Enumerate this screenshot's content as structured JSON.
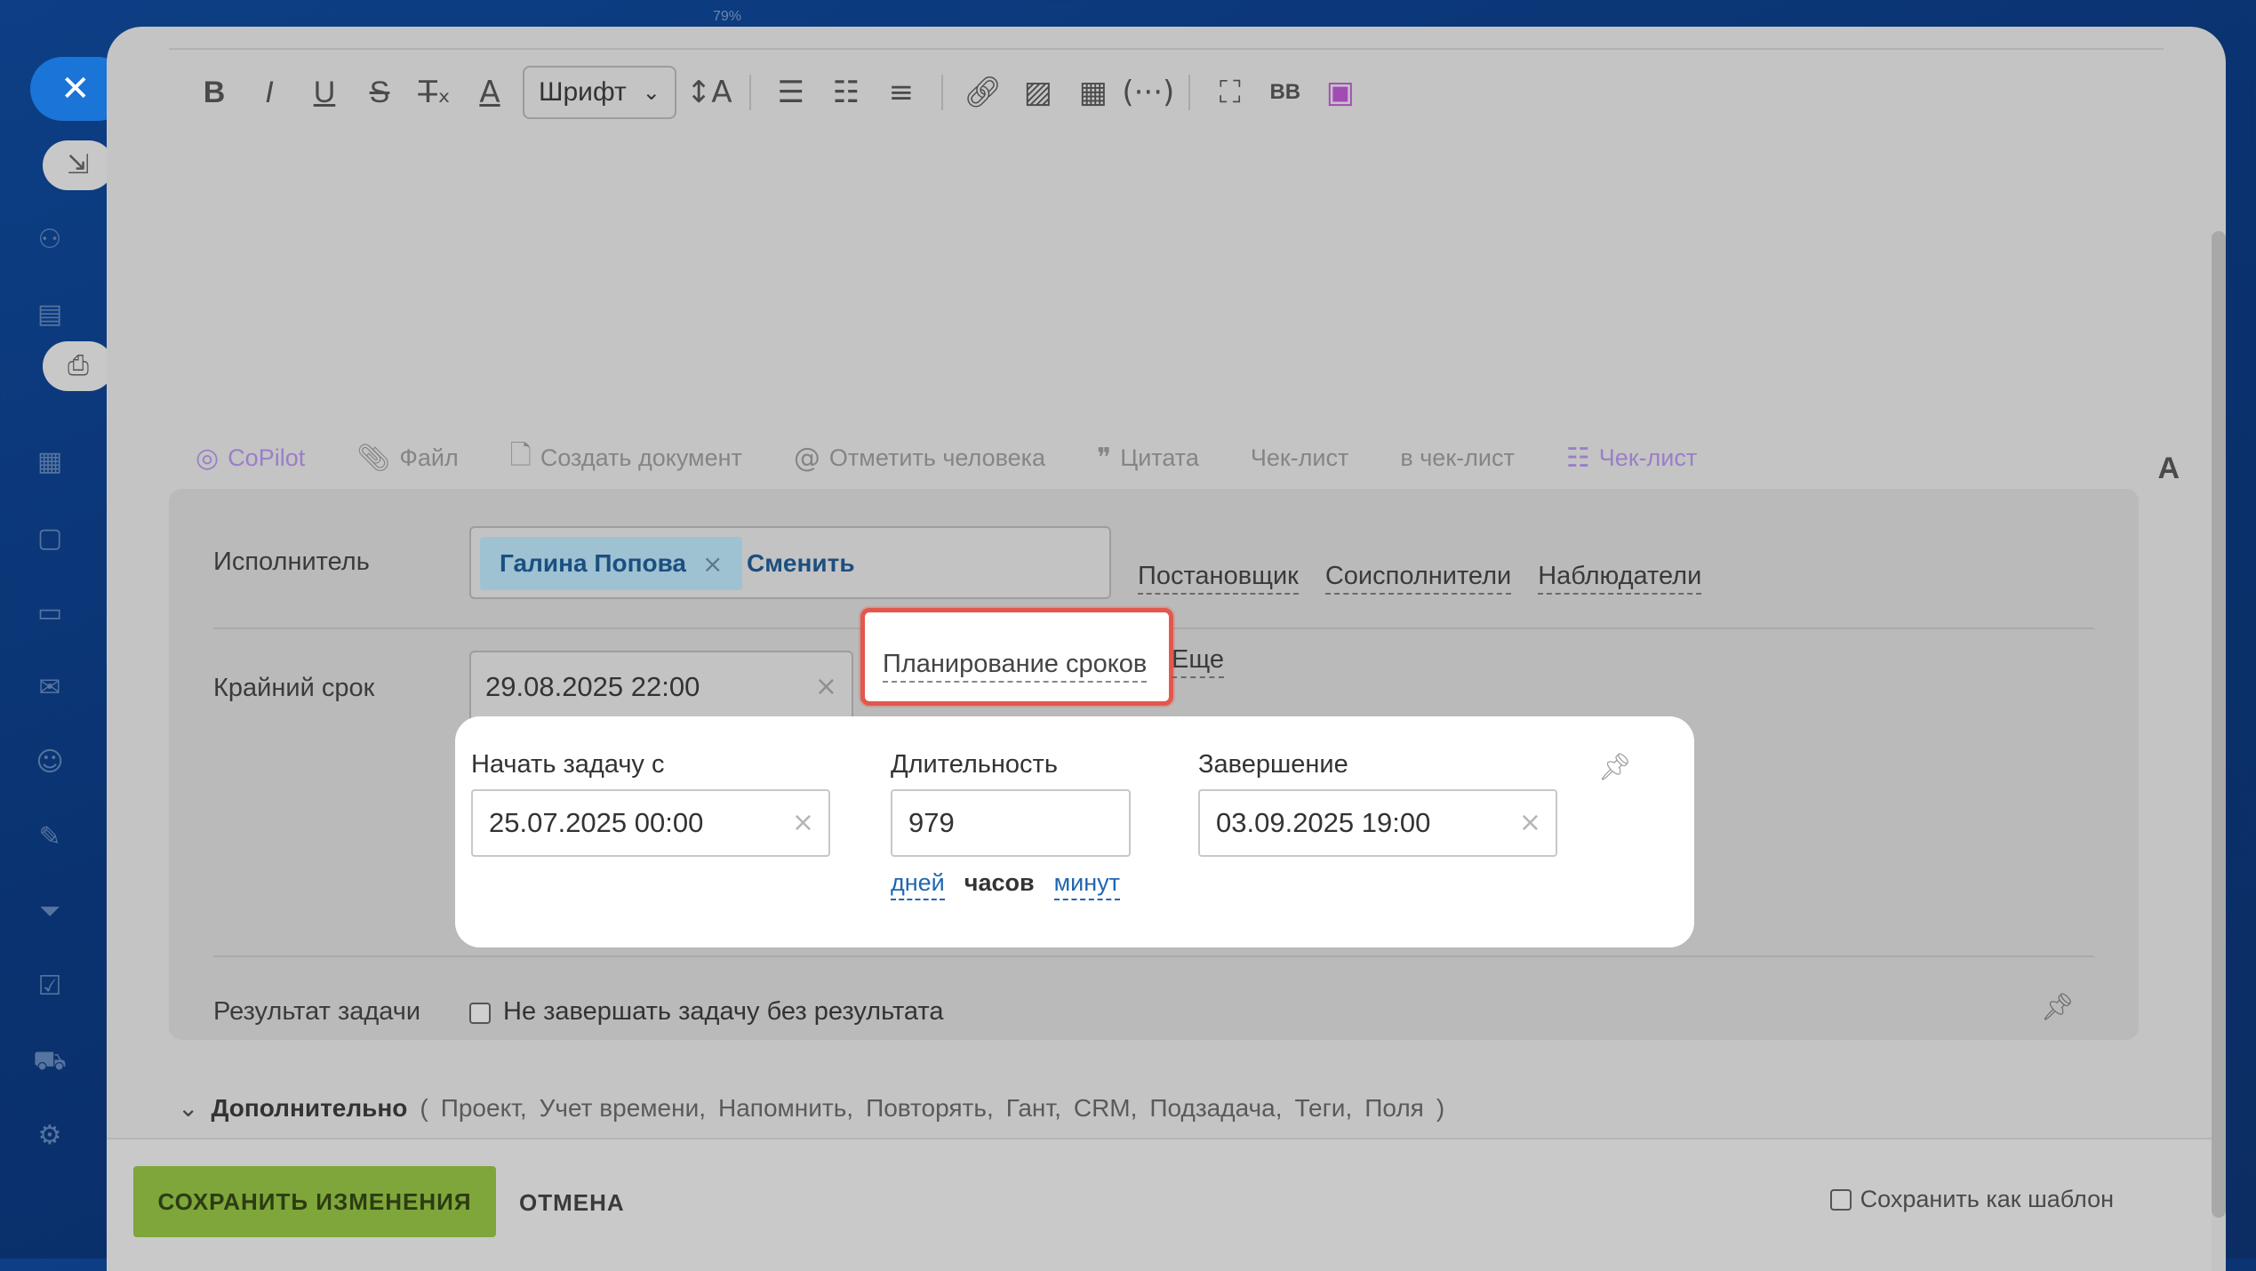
{
  "zoom_label": "79%",
  "toolbar": {
    "bold": "B",
    "italic": "I",
    "underline": "U",
    "strike": "S",
    "font_select": "Шрифт",
    "bbcode": "BB"
  },
  "attach_bar": {
    "copilot": "CoPilot",
    "file": "Файл",
    "create_doc": "Создать документ",
    "mention": "Отметить человека",
    "quote": "Цитата",
    "checklist": "Чек-лист",
    "to_checklist": "в чек-лист",
    "checklist2": "Чек-лист",
    "format_a": "A"
  },
  "form": {
    "assignee_label": "Исполнитель",
    "assignee_name": "Галина Попова",
    "change_label": "Сменить",
    "roles": [
      "Постановщик",
      "Соисполнители",
      "Наблюдатели"
    ],
    "deadline_label": "Крайний срок",
    "deadline_value": "29.08.2025 22:00",
    "planning_label": "Планирование сроков",
    "more_label": "Еще",
    "result_label": "Результат задачи",
    "result_checkbox": "Не завершать задачу без результата"
  },
  "planning": {
    "start_label": "Начать задачу с",
    "start_value": "25.07.2025 00:00",
    "duration_label": "Длительность",
    "duration_value": "979",
    "end_label": "Завершение",
    "end_value": "03.09.2025 19:00",
    "units": {
      "days": "дней",
      "hours": "часов",
      "minutes": "минут"
    }
  },
  "extra": {
    "title": "Дополнительно",
    "open_paren": "(",
    "items": [
      "Проект,",
      "Учет времени,",
      "Напомнить,",
      "Повторять,",
      "Гант,",
      "CRM,",
      "Подзадача,",
      "Теги,",
      "Поля"
    ],
    "close_paren": ")"
  },
  "footer": {
    "save": "СОХРАНИТЬ ИЗМЕНЕНИЯ",
    "cancel": "ОТМЕНА",
    "save_template": "Сохранить как шаблон"
  },
  "colors": {
    "accent_save": "#7ea63a",
    "highlight_border": "#e4574c",
    "link": "#2067b0",
    "close_button": "#1b74d8"
  }
}
